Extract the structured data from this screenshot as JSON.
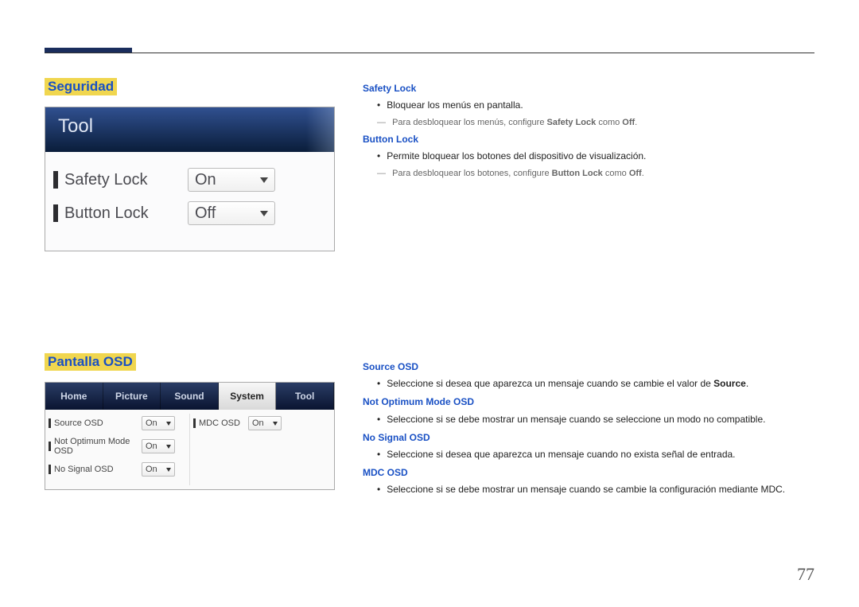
{
  "seguridad": {
    "title": "Seguridad",
    "panelTitle": "Tool",
    "rows": [
      {
        "label": "Safety Lock",
        "value": "On"
      },
      {
        "label": "Button Lock",
        "value": "Off"
      }
    ]
  },
  "seguridadDesc": {
    "safetyLock": {
      "heading": "Safety Lock",
      "bullet": "Bloquear los menús en pantalla.",
      "note_pre": "Para desbloquear los menús, configure ",
      "note_b1": "Safety Lock",
      "note_mid": " como ",
      "note_b2": "Off",
      "note_post": "."
    },
    "buttonLock": {
      "heading": "Button Lock",
      "bullet": "Permite bloquear los botones del dispositivo de visualización.",
      "note_pre": "Para desbloquear los botones, configure ",
      "note_b1": "Button Lock",
      "note_mid": " como ",
      "note_b2": "Off",
      "note_post": "."
    }
  },
  "pantalla": {
    "title": "Pantalla OSD",
    "tabs": [
      "Home",
      "Picture",
      "Sound",
      "System",
      "Tool"
    ],
    "activeTab": "System",
    "left": [
      {
        "label": "Source OSD",
        "value": "On"
      },
      {
        "label": "Not Optimum Mode OSD",
        "value": "On"
      },
      {
        "label": "No Signal OSD",
        "value": "On"
      }
    ],
    "right": [
      {
        "label": "MDC OSD",
        "value": "On"
      }
    ]
  },
  "pantallaDesc": {
    "source": {
      "heading": "Source OSD",
      "pre": "Seleccione si desea que aparezca un mensaje cuando se cambie el valor de ",
      "bold": "Source",
      "post": "."
    },
    "notOptimum": {
      "heading": "Not Optimum Mode OSD",
      "text": "Seleccione si se debe mostrar un mensaje cuando se seleccione un modo no compatible."
    },
    "noSignal": {
      "heading": "No Signal OSD",
      "text": "Seleccione si desea que aparezca un mensaje cuando no exista señal de entrada."
    },
    "mdc": {
      "heading": "MDC OSD",
      "text": "Seleccione si se debe mostrar un mensaje cuando se cambie la configuración mediante MDC."
    }
  },
  "pageNumber": "77"
}
